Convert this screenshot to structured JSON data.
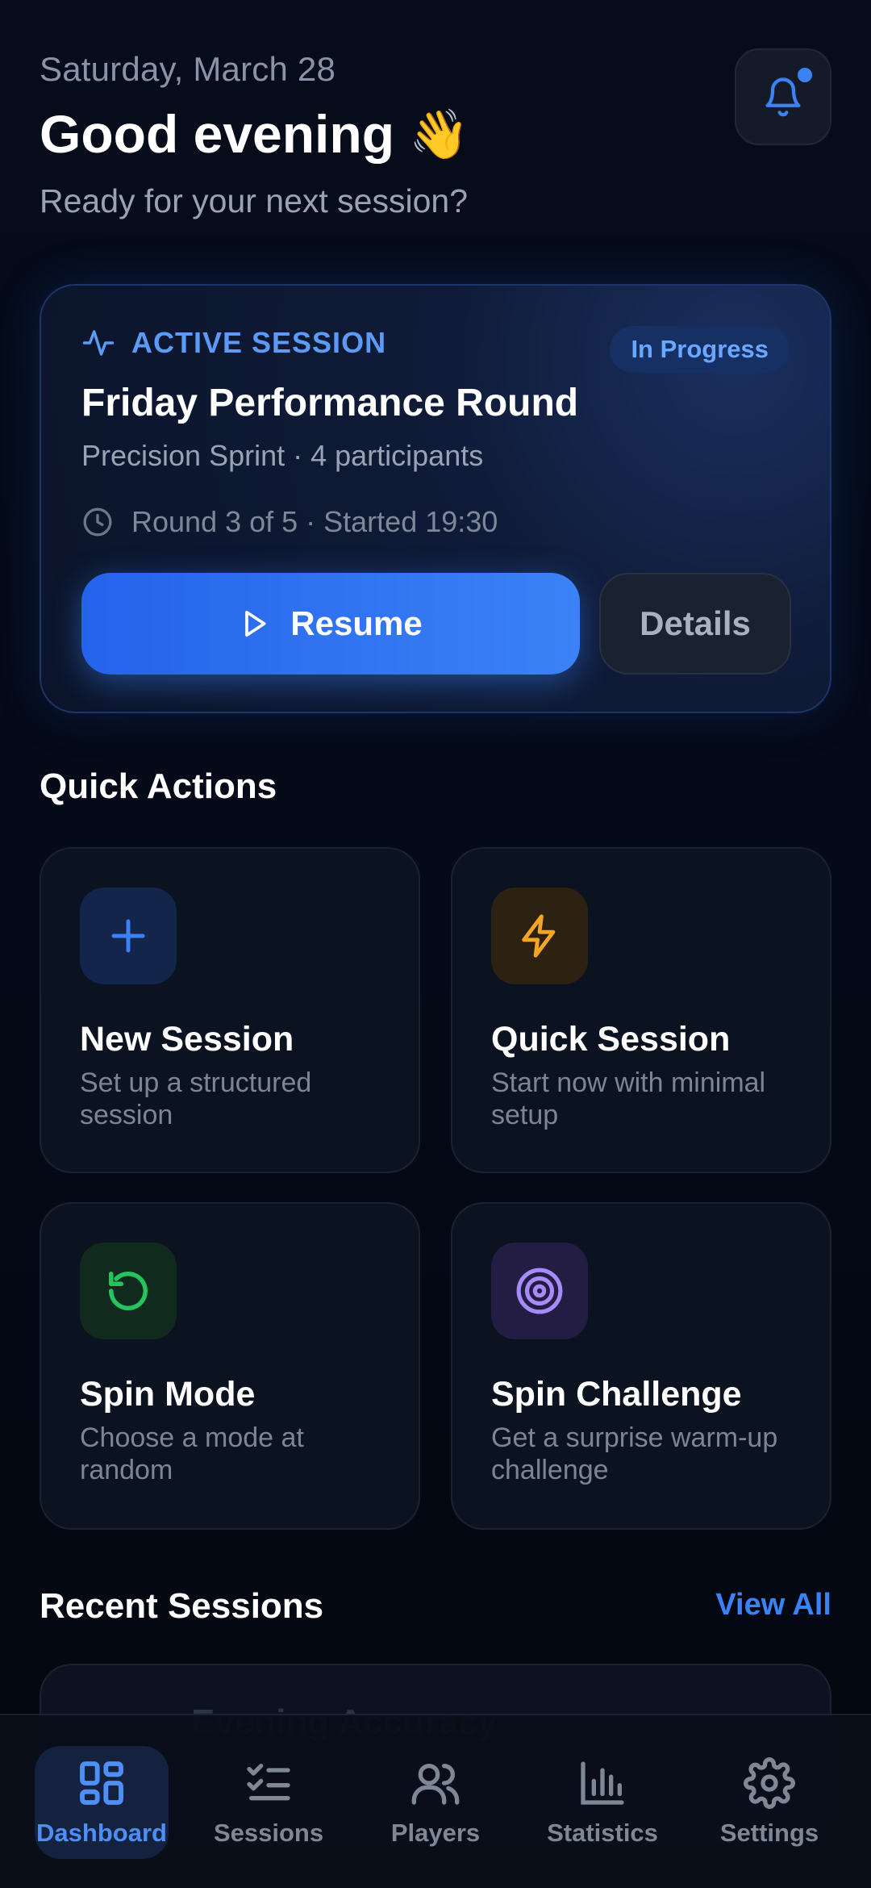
{
  "header": {
    "date": "Saturday, March 28",
    "greeting": "Good evening",
    "greeting_emoji": "👋",
    "subtitle": "Ready for your next session?",
    "notification_icon": "bell-icon",
    "has_unread": true
  },
  "active_session": {
    "label": "ACTIVE SESSION",
    "status_badge": "In Progress",
    "title": "Friday Performance Round",
    "meta": "Precision Sprint · 4 participants",
    "round_info": "Round 3 of 5 · Started 19:30",
    "resume_label": "Resume",
    "details_label": "Details"
  },
  "quick_actions": {
    "title": "Quick Actions",
    "items": [
      {
        "name": "New Session",
        "desc": "Set up a structured session",
        "icon": "plus-icon",
        "color": "#3b82f6"
      },
      {
        "name": "Quick Session",
        "desc": "Start now with minimal setup",
        "icon": "lightning-icon",
        "color": "#f5a524"
      },
      {
        "name": "Spin Mode",
        "desc": "Choose a mode at random",
        "icon": "rotate-icon",
        "color": "#22c55e"
      },
      {
        "name": "Spin Challenge",
        "desc": "Get a surprise warm-up challenge",
        "icon": "target-icon",
        "color": "#a78bfa"
      }
    ]
  },
  "recent_sessions": {
    "title": "Recent Sessions",
    "view_all": "View All",
    "items": [
      {
        "name": "Evening Accuracy"
      }
    ]
  },
  "bottom_nav": {
    "items": [
      {
        "label": "Dashboard",
        "icon": "grid-icon",
        "active": true
      },
      {
        "label": "Sessions",
        "icon": "checklist-icon",
        "active": false
      },
      {
        "label": "Players",
        "icon": "users-icon",
        "active": false
      },
      {
        "label": "Statistics",
        "icon": "bar-chart-icon",
        "active": false
      },
      {
        "label": "Settings",
        "icon": "gear-icon",
        "active": false
      }
    ]
  },
  "colors": {
    "accent": "#3b82f6",
    "background": "#050a16",
    "card": "#0c1320"
  }
}
